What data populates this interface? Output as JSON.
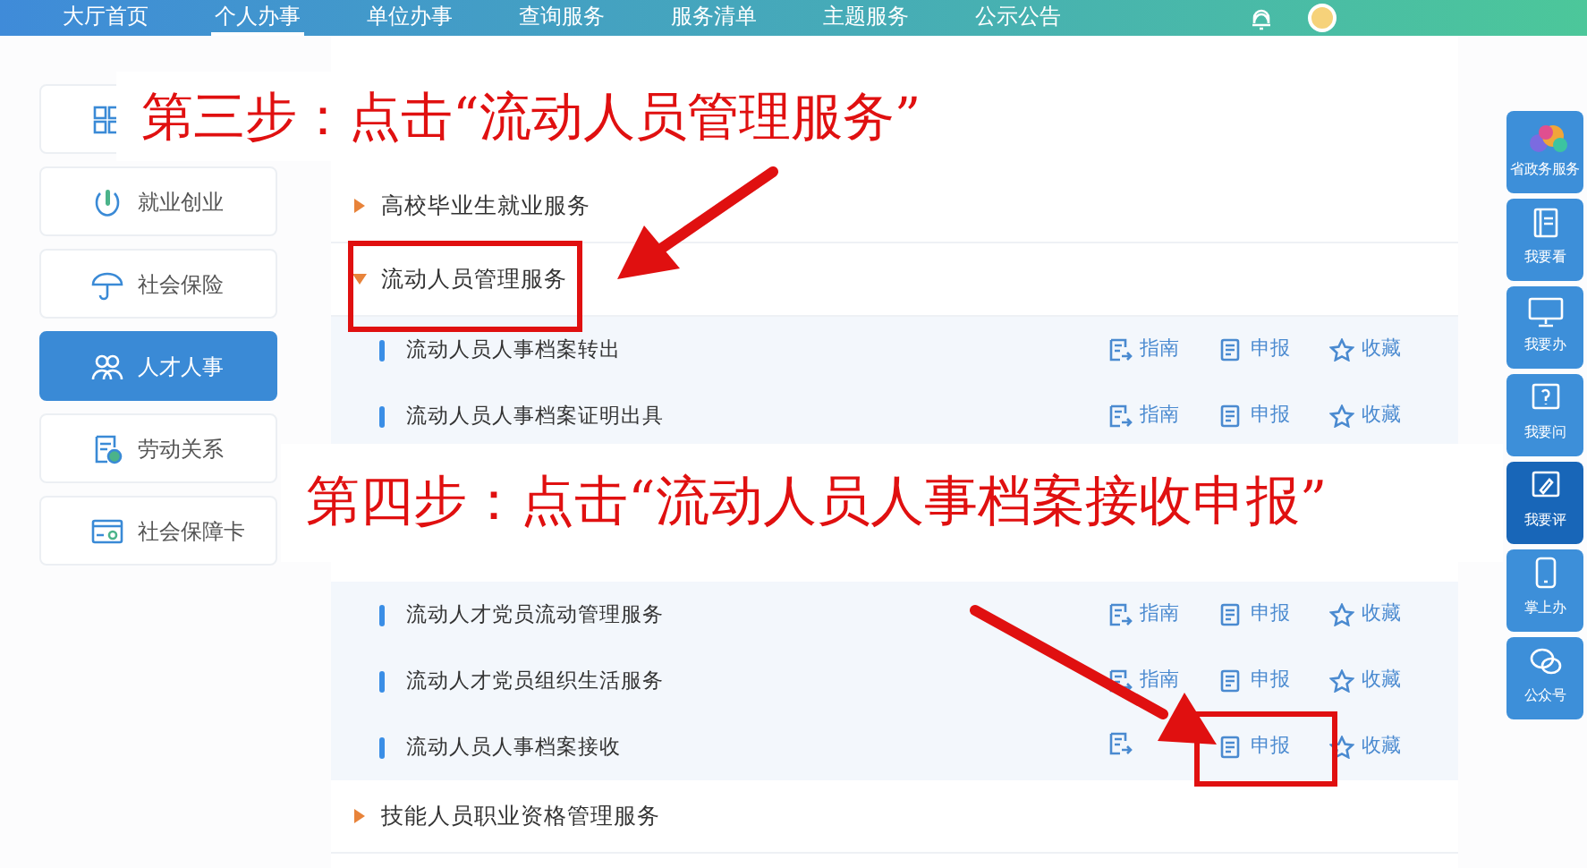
{
  "nav": {
    "items": [
      {
        "label": "大厅首页",
        "selected": false
      },
      {
        "label": "个人办事",
        "selected": true
      },
      {
        "label": "单位办事",
        "selected": false
      },
      {
        "label": "查询服务",
        "selected": false
      },
      {
        "label": "服务清单",
        "selected": false
      },
      {
        "label": "主题服务",
        "selected": false
      },
      {
        "label": "公示公告",
        "selected": false
      }
    ]
  },
  "sidebar": {
    "items": [
      {
        "kind": "grid",
        "selected": false
      },
      {
        "kind": "employment",
        "label": "就业创业",
        "selected": false
      },
      {
        "kind": "umbrella",
        "label": "社会保险",
        "selected": false
      },
      {
        "kind": "people",
        "label": "人才人事",
        "selected": true
      },
      {
        "kind": "labor",
        "label": "劳动关系",
        "selected": false
      },
      {
        "kind": "card",
        "label": "社会保障卡",
        "selected": false
      }
    ]
  },
  "services": [
    {
      "label": "高校毕业生就业服务",
      "expanded": false
    },
    {
      "label": "流动人员管理服务",
      "expanded": true,
      "children": [
        {
          "label": "流动人员人事档案转出",
          "actions": [
            {
              "kind": "guide",
              "label": "指南"
            },
            {
              "kind": "report",
              "label": "申报"
            },
            {
              "kind": "favorite",
              "label": "收藏"
            }
          ]
        },
        {
          "label": "流动人员人事档案证明出具",
          "actions": [
            {
              "kind": "guide",
              "label": "指南"
            },
            {
              "kind": "report",
              "label": "申报"
            },
            {
              "kind": "favorite",
              "label": "收藏"
            }
          ]
        },
        {
          "label": "流动人才党员流动管理服务",
          "actions": [
            {
              "kind": "guide",
              "label": "指南"
            },
            {
              "kind": "report",
              "label": "申报"
            },
            {
              "kind": "favorite",
              "label": "收藏"
            }
          ]
        },
        {
          "label": "流动人才党员组织生活服务",
          "actions": [
            {
              "kind": "guide",
              "label": "指南"
            },
            {
              "kind": "report",
              "label": "申报"
            },
            {
              "kind": "favorite",
              "label": "收藏"
            }
          ]
        },
        {
          "label": "流动人员人事档案接收",
          "actions": [
            {
              "kind": "guide"
            },
            {
              "kind": "report",
              "label": "申报"
            },
            {
              "kind": "favorite",
              "label": "收藏"
            }
          ]
        }
      ]
    },
    {
      "label": "技能人员职业资格管理服务",
      "expanded": false
    }
  ],
  "float_bar": {
    "items": [
      {
        "kind": "logo",
        "label": "省政务服务",
        "selected": false
      },
      {
        "kind": "book",
        "label": "我要看",
        "selected": false
      },
      {
        "kind": "monitor",
        "label": "我要办",
        "selected": false
      },
      {
        "kind": "question",
        "label": "我要问",
        "selected": false
      },
      {
        "kind": "comment",
        "label": "我要评",
        "selected": true
      },
      {
        "kind": "phone",
        "label": "掌上办",
        "selected": false
      },
      {
        "kind": "chat",
        "label": "公众号",
        "selected": false
      }
    ]
  },
  "annotations": [
    {
      "kind": "caption",
      "text": "第三步：点击“流动人员管理服务”"
    },
    {
      "kind": "caption",
      "text": "第四步：点击“流动人员人事档案接收申报”"
    }
  ]
}
